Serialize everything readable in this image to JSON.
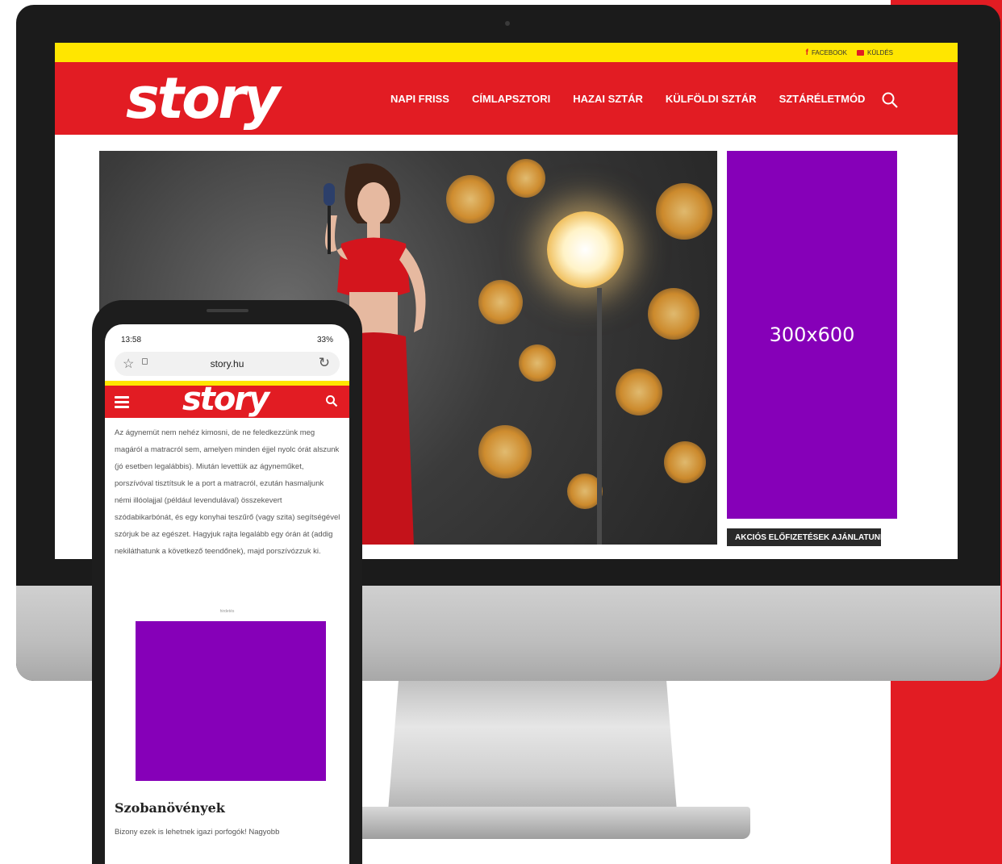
{
  "brand": {
    "accent": "#e21c23",
    "yellow": "#ffe600",
    "ad_purple": "#8600b8"
  },
  "desktop": {
    "top_links": [
      {
        "icon": "facebook-icon",
        "label": "FACEBOOK"
      },
      {
        "icon": "mail-icon",
        "label": "KÜLDÉS"
      }
    ],
    "logo": "story",
    "nav": [
      "NAPI FRISS",
      "CÍMLAPSZTORI",
      "HAZAI SZTÁR",
      "KÜLFÖLDI SZTÁR",
      "SZTÁRÉLETMÓD"
    ],
    "search_icon": "search-icon",
    "ad_label": "300x600",
    "promo_tab": "AKCIÓS ELŐFIZETÉSEK AJÁNLATUNK"
  },
  "phone": {
    "status": {
      "time": "13:58",
      "battery": "33%"
    },
    "url": "story.hu",
    "logo": "story",
    "article_text": "Az ágynemüt nem nehéz kimosni, de ne feledkezzünk meg magáról a matracról sem, amelyen minden éjjel nyolc órát alszunk (jó esetben legalábbis). Miután levettük az ágyneműket, porszívóval tisztítsuk le a port a matracról, ezután hasmaljunk némi illóolajjal (például levendulával) összekevert szódabikarbónát, és egy konyhai teszűrő (vagy szita) segítségével szórjuk be az egészet. Hagyjuk rajta legalább egy órán át (addig nekiláthatunk a következő teendőnek), majd porszívózzuk ki.",
    "ad_note": "hirdetés",
    "section_heading": "Szobanövények",
    "teaser": "Bizony ezek is lehetnek igazi porfogók! Nagyobb"
  }
}
